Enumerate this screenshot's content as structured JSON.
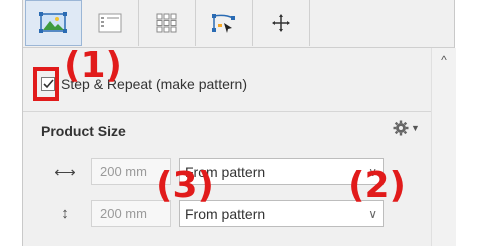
{
  "toolbar": {
    "tabs": [
      {
        "icon": "image-frame-icon",
        "active": true
      },
      {
        "icon": "layout-grid-icon",
        "active": false
      },
      {
        "icon": "tiles-icon",
        "active": false
      },
      {
        "icon": "path-edit-icon",
        "active": false
      },
      {
        "icon": "crosshair-icon",
        "active": false
      }
    ]
  },
  "step_repeat": {
    "checked": true,
    "label": "Step & Repeat (make pattern)"
  },
  "product_size": {
    "title": "Product Size",
    "width": {
      "value": "200 mm",
      "mode": "From pattern"
    },
    "height": {
      "value": "200 mm",
      "mode": "From pattern"
    }
  },
  "annotations": {
    "one": "(1)",
    "two": "(2)",
    "three": "(3)"
  },
  "colors": {
    "callout": "#e11b1b",
    "active_tab": "#dfe9f5"
  }
}
